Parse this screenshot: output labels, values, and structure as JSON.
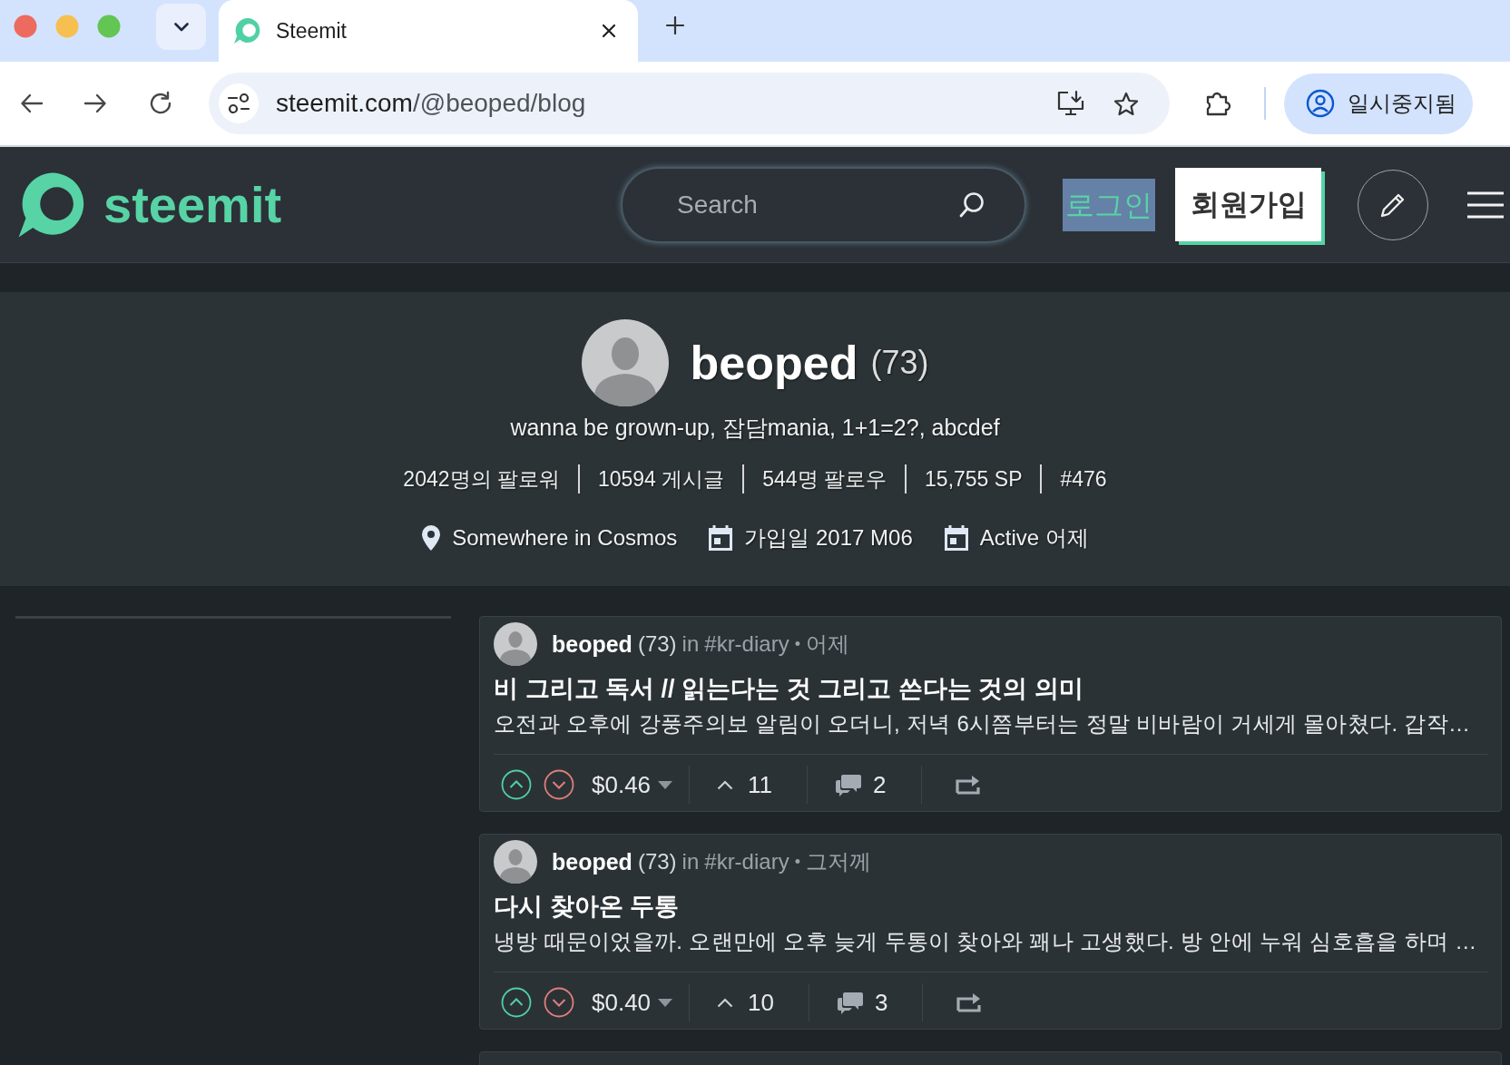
{
  "browser": {
    "tabs": [
      {
        "title": "Steemit",
        "selected": true
      }
    ],
    "address": {
      "domain": "steemit.com",
      "path": "/@beoped/blog"
    },
    "profile_button": {
      "label": "일시중지됨"
    }
  },
  "header": {
    "logo": "steemit",
    "search": {
      "placeholder": "Search"
    },
    "login": {
      "label": "로그인",
      "highlighted": true
    },
    "signup": {
      "label": "회원가입"
    }
  },
  "profile": {
    "name": "beoped",
    "reputation": "(73)",
    "bio": "wanna be grown-up, 잡담mania, 1+1=2?, abcdef",
    "stats": [
      "2042명의 팔로워",
      "10594 게시글",
      "544명 팔로우",
      "15,755 SP",
      "#476"
    ],
    "details": [
      {
        "kind": "location",
        "text": "Somewhere in Cosmos"
      },
      {
        "kind": "calendar",
        "text": "가입일 2017 M06"
      },
      {
        "kind": "calendar",
        "text": "Active 어제"
      }
    ]
  },
  "posts": [
    {
      "author": "beoped",
      "reputation": "(73)",
      "in": "in",
      "category": "#kr-diary",
      "bullet": "•",
      "time": "어제",
      "title": "비 그리고 독서 // 읽는다는 것 그리고 쓴다는 것의 의미",
      "excerpt": "오전과 오후에 강풍주의보 알림이 오더니, 저녁 6시쯤부터는 정말 비바람이 거세게 몰아쳤다. 갑작…",
      "payout": "$0.46",
      "votes": "11",
      "comments": "2"
    },
    {
      "author": "beoped",
      "reputation": "(73)",
      "in": "in",
      "category": "#kr-diary",
      "bullet": "•",
      "time": "그저께",
      "title": "다시 찾아온 두통",
      "excerpt": "냉방 때문이었을까. 오랜만에 오후 늦게 두통이 찾아와 꽤나 고생했다. 방 안에 누워 심호흡을 하며 …",
      "payout": "$0.40",
      "votes": "10",
      "comments": "3"
    }
  ]
}
